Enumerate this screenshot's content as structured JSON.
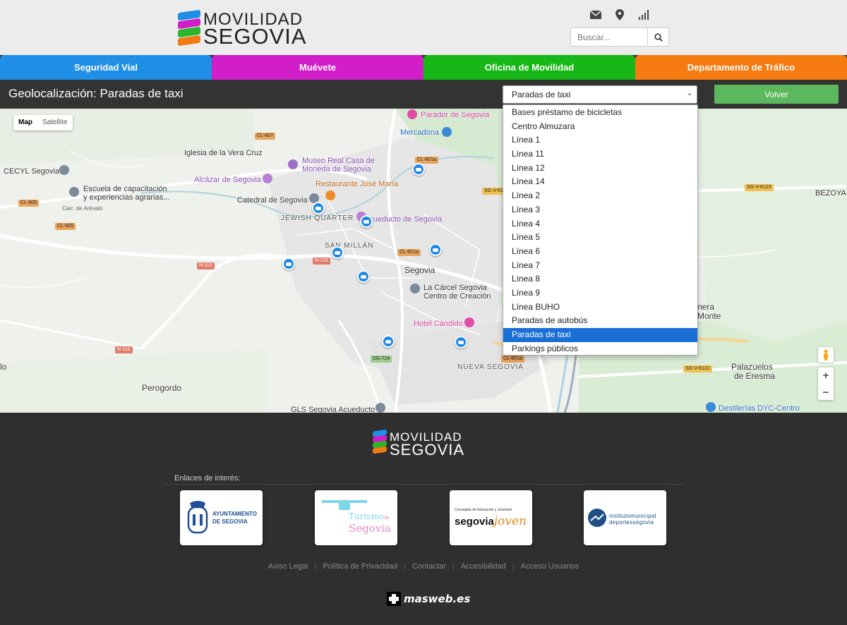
{
  "brand": {
    "line1": "MOVILIDAD",
    "line2": "SEGOVIA",
    "colors": [
      "#1e8ee6",
      "#d21ec8",
      "#2bb52b",
      "#f07a14"
    ]
  },
  "header": {
    "icons": [
      "envelope-icon",
      "map-pin-icon",
      "signal-icon"
    ],
    "search_placeholder": "Buscar..."
  },
  "nav": [
    {
      "label": "Seguridad Vial",
      "color": "#1e8ee6"
    },
    {
      "label": "Muévete",
      "color": "#d21ec8"
    },
    {
      "label": "Oficina de Movilidad",
      "color": "#17b717"
    },
    {
      "label": "Departamento de Tráfico",
      "color": "#f57a10"
    }
  ],
  "toolbar": {
    "title": "Geolocalización: Paradas de taxi",
    "select_value": "Paradas de taxi",
    "back_label": "Volver"
  },
  "dropdown": {
    "options": [
      "Bases préstamo de bicicletas",
      "Centro Almuzara",
      "Línea 1",
      "Línea 11",
      "Línea 12",
      "Línea 14",
      "Línea 2",
      "Línea 3",
      "Línea 4",
      "Línea 5",
      "Línea 6",
      "Línea 7",
      "Línea 8",
      "Línea 9",
      "Línea BUHO",
      "Paradas de autobús",
      "Paradas de taxi",
      "Parkings públicos"
    ],
    "selected": "Paradas de taxi"
  },
  "map": {
    "type_map": "Map",
    "type_satellite": "Satellite",
    "zoom_in": "+",
    "zoom_out": "−",
    "labels": {
      "parador": "Parador de Segovia",
      "mercadona": "Mercadona",
      "iglesia": "Iglesia de la Vera Cruz",
      "museo1": "Museo Real Casa de",
      "museo2": "Moneda de Segovia",
      "cecyl": "CECYL Segovia",
      "alcazar": "Alcázar de Segovia",
      "restaurante": "Restaurante José María",
      "escuela1": "Escuela de capacitación",
      "escuela2": "y experiencias agrarias...",
      "catedral": "Catedral de Segovia",
      "carr": "Carr. de Arévalo",
      "jewish": "JEWISH QUARTER",
      "acueducto": "Acueducto de Segovia",
      "sanmillan": "SAN MILLÁN",
      "segovia": "Segovia",
      "carcel1": "La Cárcel Segovia",
      "carcel2": "Centro de Creación",
      "hotel": "Hotel Cándido",
      "nuevasegovia": "NUEVA SEGOVIA",
      "perogordo": "Perogordo",
      "gls": "GLS Segovia Acueducto",
      "bezoya": "BEZOYA",
      "nera": "nera",
      "monte": "Monte",
      "palazuelos1": "Palazuelos",
      "palazuelos2": "de Eresma",
      "destilerias": "Destilerías DYC-Centro",
      "lo": "lo"
    },
    "shields": {
      "cl607": "CL-607",
      "cl601a": "CL-601a",
      "cl605": "CL-605",
      "sgv6121": "SG-V-612",
      "sgv6123": "SG-V-6123",
      "n110a": "N-110",
      "n110b": "N-110",
      "cl601b": "CL-601a",
      "n110c": "N-110",
      "sg724": "SG-724",
      "cl601c": "CL-601a",
      "sgv6122": "SG-V-6122"
    }
  },
  "footer": {
    "links_heading": "Enlaces de interés:",
    "partners": [
      {
        "name": "ayuntamiento",
        "line1": "AYUNTAMIENTO",
        "line2": "DE SEGOVIA"
      },
      {
        "name": "turismo",
        "line1": "Turismo",
        "line2": "Segovia",
        "prefix": "de"
      },
      {
        "name": "segovia-joven",
        "line0": "Concejalía de Educación y Juventud",
        "line1": "segovia",
        "line2": "joven"
      },
      {
        "name": "imd",
        "line1": "institutomunicipal",
        "line2": "deportessegovia"
      }
    ],
    "links": [
      "Aviso Legal",
      "Política de Privacidad",
      "Contactar",
      "Accesibilidad",
      "Acceso Usuarios"
    ],
    "credit": "masweb.es"
  }
}
